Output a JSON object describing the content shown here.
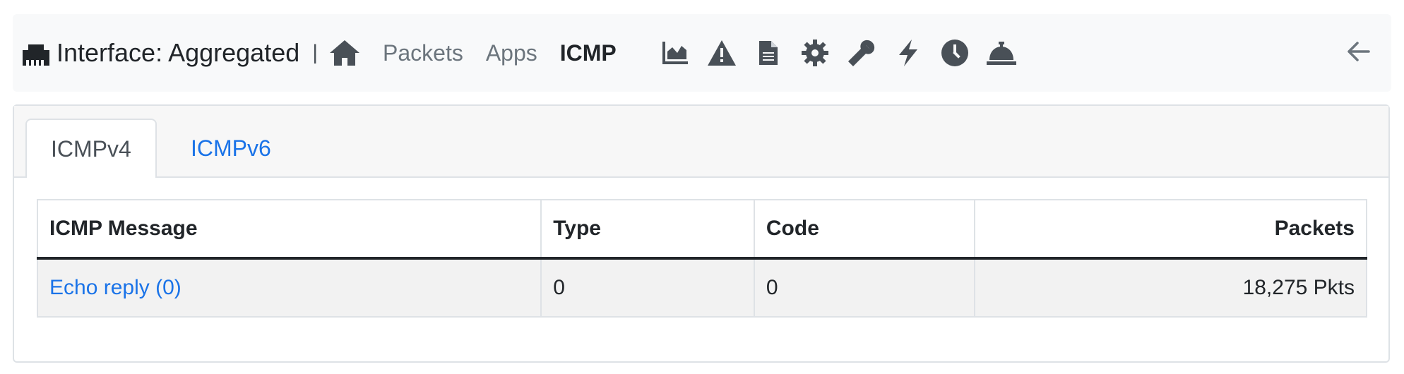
{
  "header": {
    "title": "Interface: Aggregated",
    "separator": "|",
    "nav": {
      "home_icon": "home-icon",
      "packets": "Packets",
      "apps": "Apps",
      "icmp": "ICMP"
    },
    "tool_icons": [
      "chart-area-icon",
      "warning-icon",
      "document-icon",
      "gear-icon",
      "wrench-icon",
      "bolt-icon",
      "clock-icon",
      "bell-concierge-icon"
    ],
    "back_icon": "arrow-left-icon"
  },
  "tabs": [
    {
      "label": "ICMPv4",
      "active": true
    },
    {
      "label": "ICMPv6",
      "active": false
    }
  ],
  "table": {
    "columns": [
      "ICMP Message",
      "Type",
      "Code",
      "Packets"
    ],
    "rows": [
      {
        "message": "Echo reply (0)",
        "type": "0",
        "code": "0",
        "packets": "18,275 Pkts"
      }
    ]
  },
  "colors": {
    "link": "#1a73e8",
    "text": "#212529",
    "muted": "#6c757d",
    "topbar_bg": "#f8f9fa"
  }
}
